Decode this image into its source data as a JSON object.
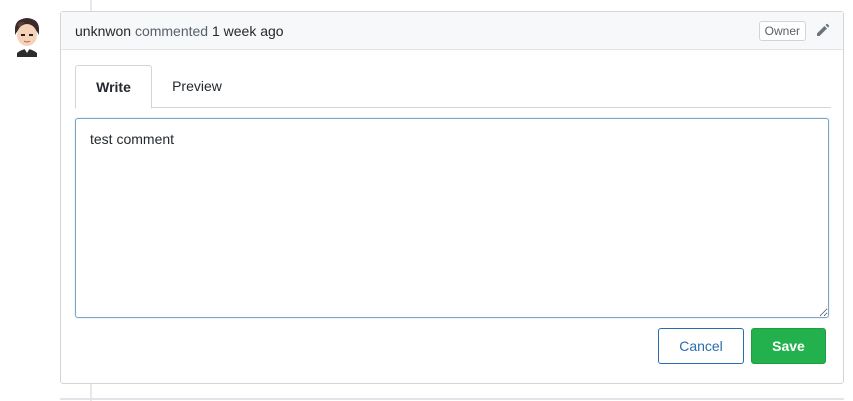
{
  "comment": {
    "author": "unknwon",
    "action": "commented",
    "time": "1 week ago",
    "role_badge": "Owner",
    "edit_icon": "pencil-icon"
  },
  "avatar": {
    "icon": "avatar-cartoon-boy"
  },
  "tabs": [
    {
      "label": "Write",
      "active": true
    },
    {
      "label": "Preview",
      "active": false
    }
  ],
  "editor": {
    "value": "test comment"
  },
  "actions": {
    "cancel_label": "Cancel",
    "save_label": "Save"
  },
  "colors": {
    "save_bg": "#22b14c",
    "cancel_border": "#2b6cb0",
    "textarea_focus_border": "#7aa7c7"
  }
}
